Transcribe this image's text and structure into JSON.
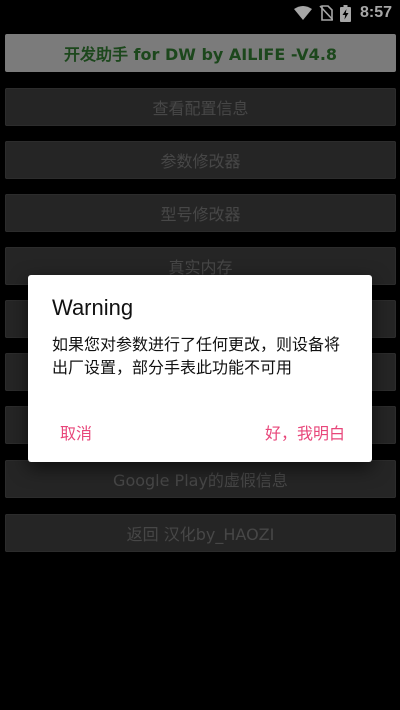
{
  "status_bar": {
    "time": "8:57",
    "icons": [
      "wifi-icon",
      "no-sim-icon",
      "battery-charging-icon"
    ]
  },
  "menu": {
    "header": "开发助手 for DW by AILIFE -V4.8",
    "items": [
      "查看配置信息",
      "参数修改器",
      "型号修改器",
      "真实内存",
      "",
      "",
      "",
      "Google Play的虚假信息",
      "返回 汉化by_HAOZI"
    ]
  },
  "dialog": {
    "title": "Warning",
    "message": "如果您对参数进行了任何更改，则设备将出厂设置，部分手表此功能不可用",
    "cancel_label": "取消",
    "confirm_label": "好，我明白"
  },
  "colors": {
    "accent": "#e8467a",
    "header_text": "#2b6e2b",
    "button_bg": "#3a3a3a",
    "header_bg": "#bdbdbd"
  }
}
